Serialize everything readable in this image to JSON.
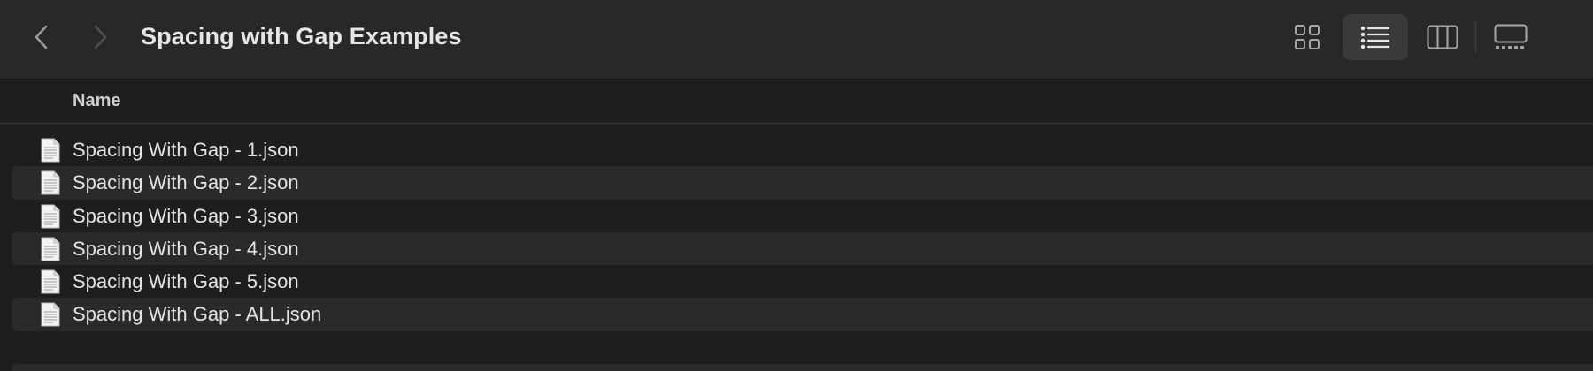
{
  "toolbar": {
    "title": "Spacing with Gap Examples",
    "back_icon": "chevron-left-icon",
    "forward_icon": "chevron-right-icon",
    "view_modes": [
      {
        "name": "icons",
        "icon": "grid-icon",
        "selected": false
      },
      {
        "name": "list",
        "icon": "list-icon",
        "selected": true
      },
      {
        "name": "columns",
        "icon": "columns-icon",
        "selected": false
      },
      {
        "name": "gallery",
        "icon": "gallery-icon",
        "selected": false
      }
    ]
  },
  "columns": {
    "name": "Name"
  },
  "files": [
    {
      "name": "Spacing With Gap - 1.json",
      "icon": "document-icon"
    },
    {
      "name": "Spacing With Gap - 2.json",
      "icon": "document-icon"
    },
    {
      "name": "Spacing With Gap - 3.json",
      "icon": "document-icon"
    },
    {
      "name": "Spacing With Gap - 4.json",
      "icon": "document-icon"
    },
    {
      "name": "Spacing With Gap - 5.json",
      "icon": "document-icon"
    },
    {
      "name": "Spacing With Gap - ALL.json",
      "icon": "document-icon"
    }
  ],
  "colors": {
    "window_bg": "#1e1e1e",
    "toolbar_bg": "#282828",
    "row_alt_bg": "#2a2a2a",
    "selected_view_bg": "#3a3a3a",
    "text": "#e4e4e4"
  }
}
